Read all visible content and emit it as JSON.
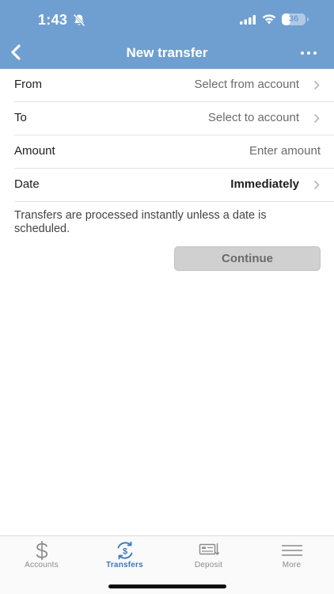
{
  "status_bar": {
    "time": "1:43",
    "battery_level": "36"
  },
  "nav": {
    "title": "New transfer"
  },
  "form": {
    "rows": [
      {
        "label": "From",
        "value": "Select from account"
      },
      {
        "label": "To",
        "value": "Select to account"
      },
      {
        "label": "Amount",
        "value": "Enter amount"
      },
      {
        "label": "Date",
        "value": "Immediately"
      }
    ],
    "note": "Transfers are processed instantly unless a date is scheduled.",
    "continue_label": "Continue"
  },
  "tabbar": {
    "tabs": [
      {
        "label": "Accounts",
        "icon": "dollar-icon"
      },
      {
        "label": "Transfers",
        "icon": "transfer-dollar-icon",
        "active": true
      },
      {
        "label": "Deposit",
        "icon": "check-deposit-icon"
      },
      {
        "label": "More",
        "icon": "menu-icon"
      }
    ]
  },
  "colors": {
    "header": "#6f9fd0",
    "accent": "#3e78b9",
    "disabled_button": "#d0d0d0"
  }
}
